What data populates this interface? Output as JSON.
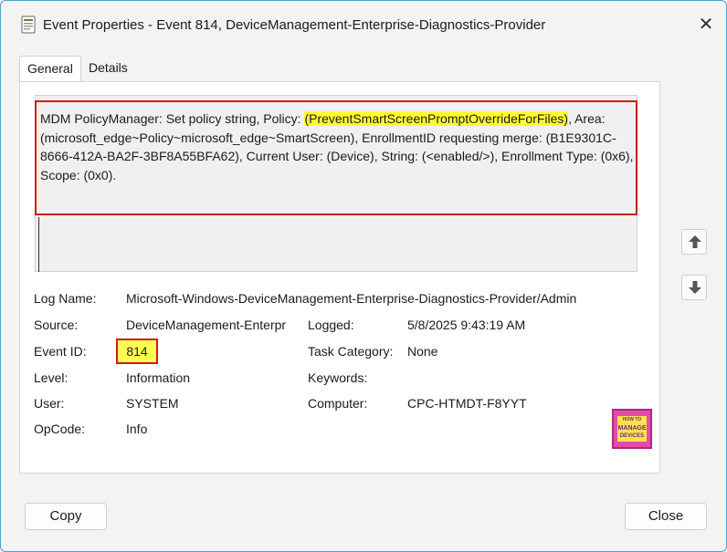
{
  "window": {
    "title": "Event Properties - Event 814, DeviceManagement-Enterprise-Diagnostics-Provider",
    "close_glyph": "✕",
    "border_color": "#4fa3c8"
  },
  "tabs": [
    {
      "label": "General",
      "active": true
    },
    {
      "label": "Details",
      "active": false
    }
  ],
  "description": {
    "part1": "MDM PolicyManager: Set policy string, Policy: ",
    "policy_highlight": "(PreventSmartScreenPromptOverrideForFiles)",
    "part2": ", Area: (microsoft_edge~Policy~microsoft_edge~SmartScreen), EnrollmentID requesting merge: (B1E9301C-8666-412A-BA2F-3BF8A55BFA62), Current User: (Device), String: (<enabled/>), Enrollment Type: (0x6), Scope: (0x0).",
    "highlight_color": "#ffff33",
    "annotation_color": "#d11a1a"
  },
  "fields": {
    "log_name_label": "Log Name:",
    "log_name_value": "Microsoft-Windows-DeviceManagement-Enterprise-Diagnostics-Provider/Admin",
    "source_label": "Source:",
    "source_value": "DeviceManagement-Enterpr",
    "logged_label": "Logged:",
    "logged_value": "5/8/2025 9:43:19 AM",
    "event_id_label": "Event ID:",
    "event_id_value": "814",
    "task_category_label": "Task Category:",
    "task_category_value": "None",
    "level_label": "Level:",
    "level_value": "Information",
    "keywords_label": "Keywords:",
    "keywords_value": "",
    "user_label": "User:",
    "user_value": "SYSTEM",
    "computer_label": "Computer:",
    "computer_value": "CPC-HTMDT-F8YYT",
    "opcode_label": "OpCode:",
    "opcode_value": "Info"
  },
  "side_buttons": {
    "up_icon": "arrow-up-icon",
    "down_icon": "arrow-down-icon"
  },
  "logo": {
    "line1": "HOW TO",
    "line2": "MANAGE",
    "line3": "DEVICES"
  },
  "buttons": {
    "copy_label": "Copy",
    "close_label": "Close"
  }
}
